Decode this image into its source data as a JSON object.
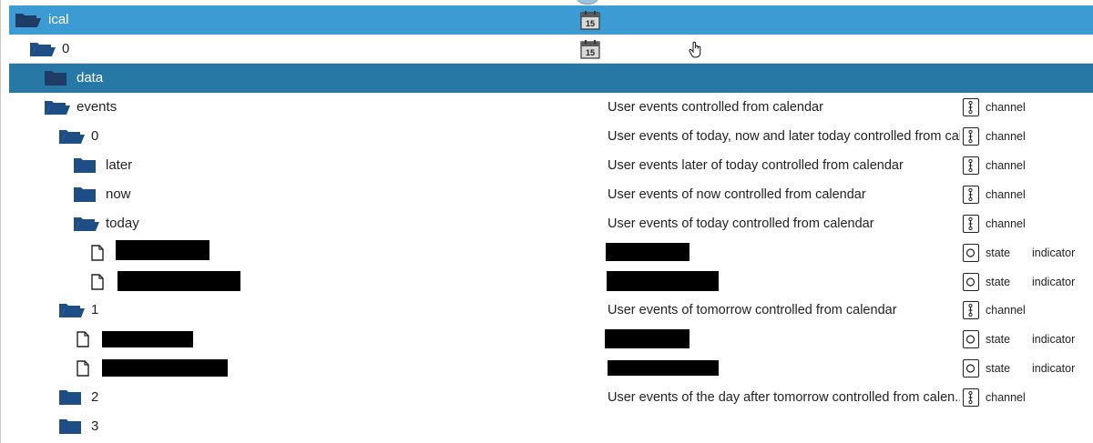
{
  "colors": {
    "selected_row": "#3d9bd4",
    "focused_row": "#2878a6",
    "folder_dark": "#1d4f86",
    "folder_light_on_blue": "#1e3c66"
  },
  "rows": [
    {
      "name": "ical",
      "desc": "",
      "type": "",
      "role": ""
    },
    {
      "name": "0",
      "desc": "",
      "type": "",
      "role": ""
    },
    {
      "name": "data",
      "desc": "",
      "type": "",
      "role": ""
    },
    {
      "name": "events",
      "desc": "User events controlled from calendar",
      "type": "channel",
      "role": ""
    },
    {
      "name": "0",
      "desc": "User events of today, now and later today controlled from cal...",
      "type": "channel",
      "role": ""
    },
    {
      "name": "later",
      "desc": "User events later of today controlled from calendar",
      "type": "channel",
      "role": ""
    },
    {
      "name": "now",
      "desc": "User events of now controlled from calendar",
      "type": "channel",
      "role": ""
    },
    {
      "name": "today",
      "desc": "User events of today controlled from calendar",
      "type": "channel",
      "role": ""
    },
    {
      "name": "",
      "desc": "",
      "type": "state",
      "role": "indicator"
    },
    {
      "name": "",
      "desc": "",
      "type": "state",
      "role": "indicator"
    },
    {
      "name": "1",
      "desc": "User events of tomorrow controlled from calendar",
      "type": "channel",
      "role": ""
    },
    {
      "name": "",
      "desc": "",
      "type": "state",
      "role": "indicator"
    },
    {
      "name": "",
      "desc": "",
      "type": "state",
      "role": "indicator"
    },
    {
      "name": "2",
      "desc": "User events of the day after tomorrow controlled from calen...",
      "type": "channel",
      "role": ""
    },
    {
      "name": "3",
      "desc": "",
      "type": "",
      "role": ""
    }
  ],
  "calendar_icon_text": "15",
  "icons": {
    "folder_open": "folder-open-icon",
    "folder_closed": "folder-closed-icon",
    "file": "file-icon",
    "channel": "channel-type-icon",
    "state": "state-type-icon",
    "calendar": "calendar-icon",
    "cursor": "hand-pointer-icon"
  }
}
